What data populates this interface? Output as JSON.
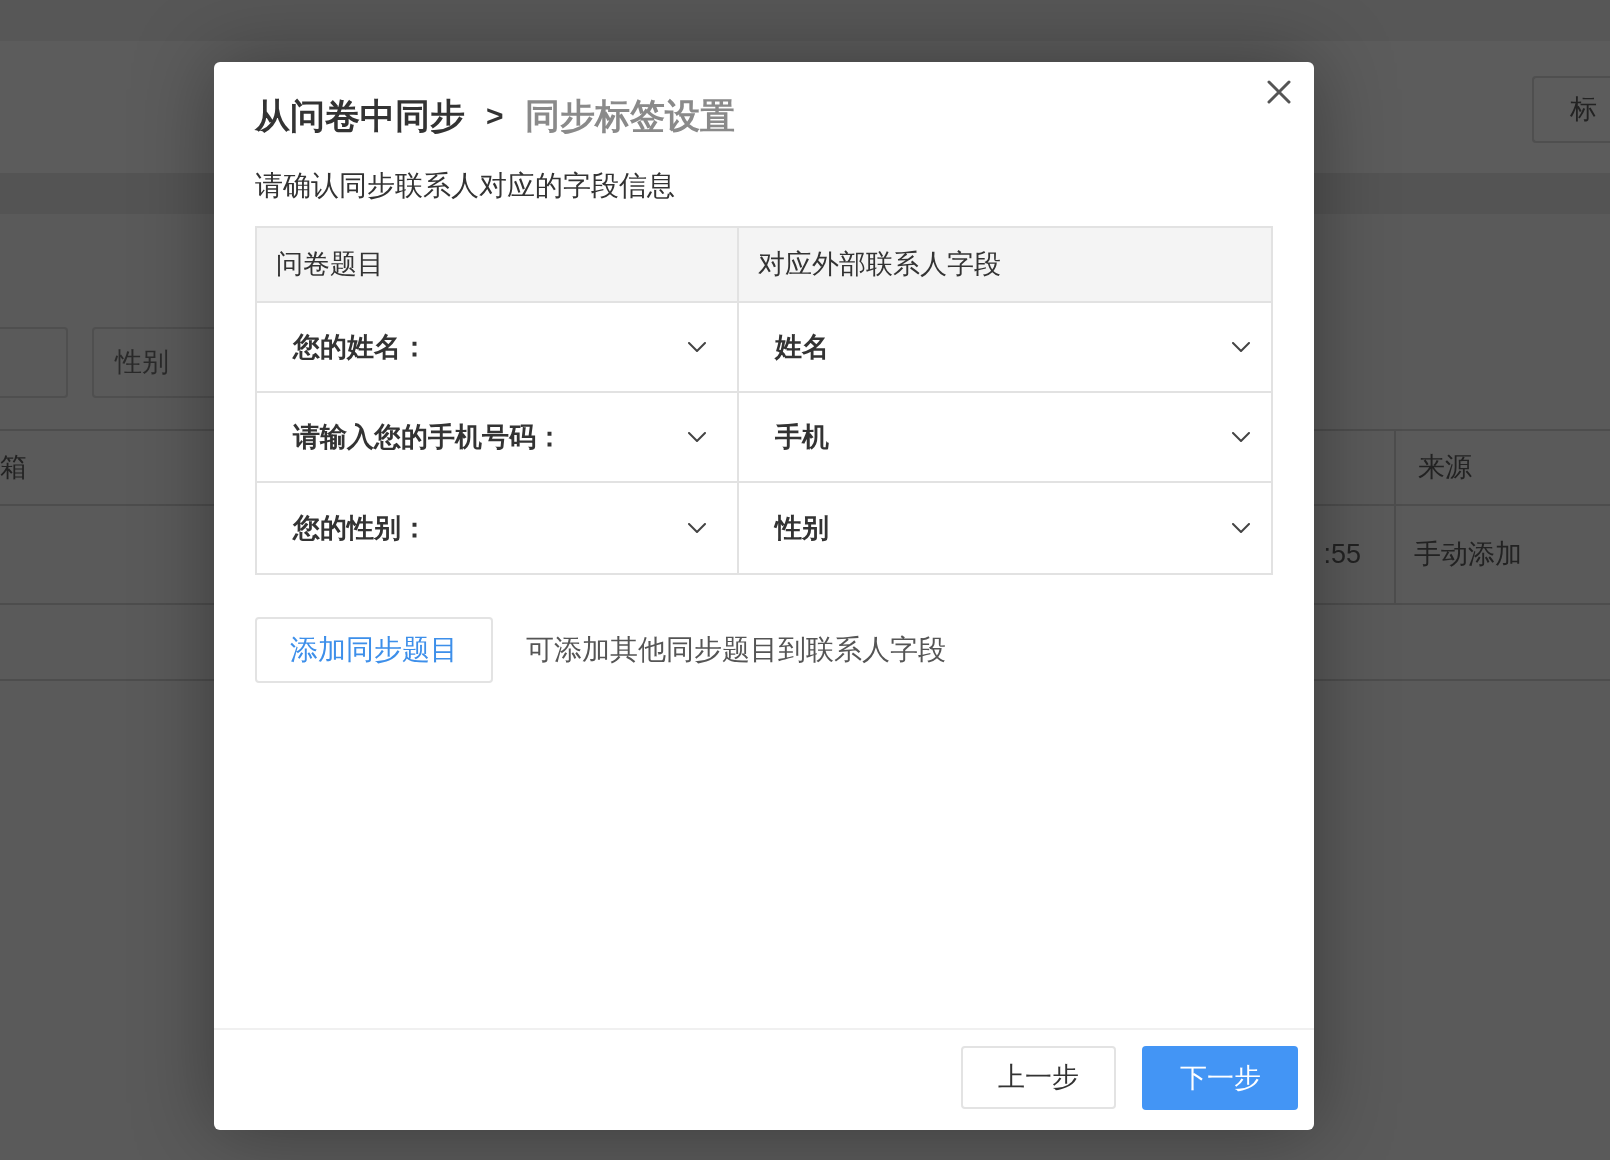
{
  "background_page": {
    "tag_button": "标",
    "filter_placeholder": "性别",
    "table": {
      "columns": [
        "箱",
        "来源"
      ],
      "rows": [
        {
          "time": ":55",
          "source": "手动添加"
        }
      ]
    }
  },
  "dialog": {
    "title": [
      {
        "label": "从问卷中同步",
        "kind": "parent"
      },
      {
        "label": ">",
        "kind": "separator"
      },
      {
        "label": "同步标签设置",
        "kind": "current"
      }
    ],
    "subtitle": "请确认同步联系人对应的字段信息",
    "table": {
      "columns": [
        "问卷题目",
        "对应外部联系人字段"
      ],
      "rows": [
        {
          "question": "您的姓名：",
          "field": "姓名"
        },
        {
          "question": "请输入您的手机号码：",
          "field": "手机"
        },
        {
          "question": "您的性别：",
          "field": "性别"
        }
      ]
    },
    "add_button": "添加同步题目",
    "add_hint": "可添加其他同步题目到联系人字段",
    "buttons": [
      {
        "label": "上一步",
        "kind": "secondary"
      },
      {
        "label": "下一步",
        "kind": "primary"
      }
    ]
  }
}
